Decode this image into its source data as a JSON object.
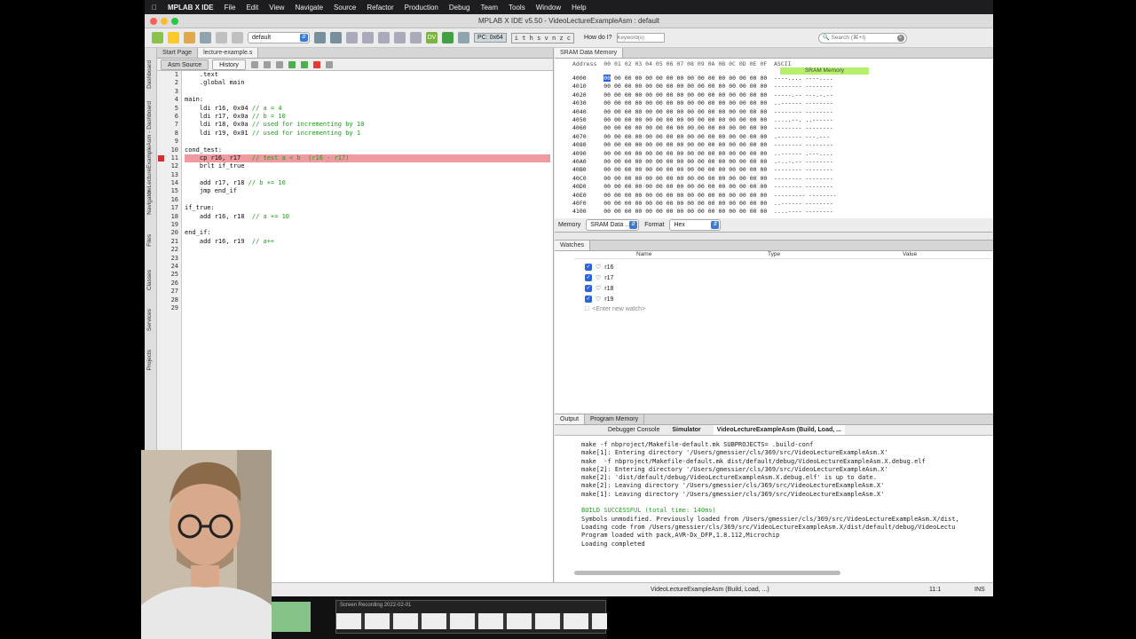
{
  "mac_menu": [
    "MPLAB X IDE",
    "File",
    "Edit",
    "View",
    "Navigate",
    "Source",
    "Refactor",
    "Production",
    "Debug",
    "Team",
    "Tools",
    "Window",
    "Help"
  ],
  "window_title": "MPLAB X IDE v5.50 - VideoLectureExampleAsm : default",
  "toolbar": {
    "config": "default",
    "pc": "PC: 0x64",
    "status_flags": "i t h s v n z c",
    "howdoi": "How do I?",
    "howdoi_placeholder": "Keyword(s)",
    "search_placeholder": "Search (⌘+I)"
  },
  "sidebar_tabs": [
    "Dashboard",
    "dwLectureExampleAsm - Dashboard",
    "Navigator",
    "Files",
    "Classes",
    "Services",
    "Projects"
  ],
  "editor": {
    "tabs": [
      "Start Page",
      "lecture-example.s"
    ],
    "subtabs": [
      "Asm Source",
      "History"
    ],
    "lines": [
      "    .text",
      "    .global main",
      "",
      "main:",
      "    ldi r16, 0x04 // a = 4",
      "    ldi r17, 0x0a // b = 10",
      "    ldi r18, 0x0a // used for incrementing by 10",
      "    ldi r19, 0x01 // used for incrementing by 1",
      "",
      "cond_test:",
      "    cp r16, r17   // test a < b  (r16 - r17)",
      "    brlt if_true",
      "",
      "    add r17, r18 // b += 10",
      "    jmp end_if",
      "",
      "if_true:",
      "    add r16, r18  // a += 10",
      "",
      "end_if:",
      "    add r16, r19  // a++",
      "",
      "",
      "",
      "",
      "",
      "",
      "",
      ""
    ],
    "breakpoint_line": 11
  },
  "sram": {
    "tab": "SRAM Data Memory",
    "header": "Address  00 01 02 03 04 05 06 07 08 09 0A 0B 0C 0D 0E 0F  ASCII",
    "overlay_label": "SRAM Memory",
    "rows": [
      {
        "addr": "4000",
        "bytes": "00 00 00 00 00 00 00 00 00 00 00 00 00 00 00 00",
        "ascii": "----.... ----...."
      },
      {
        "addr": "4010",
        "bytes": "00 00 00 00 00 00 00 00 00 00 00 00 00 00 00 00",
        "ascii": "-------- --------"
      },
      {
        "addr": "4020",
        "bytes": "00 00 00 00 00 00 00 00 00 00 00 00 00 00 00 00",
        "ascii": "-----.-- ---.-.--"
      },
      {
        "addr": "4030",
        "bytes": "00 00 00 00 00 00 00 00 00 00 00 00 00 00 00 00",
        "ascii": "..------ --------"
      },
      {
        "addr": "4040",
        "bytes": "00 00 00 00 00 00 00 00 00 00 00 00 00 00 00 00",
        "ascii": "-------- --------"
      },
      {
        "addr": "4050",
        "bytes": "00 00 00 00 00 00 00 00 00 00 00 00 00 00 00 00",
        "ascii": ".....--. ..------"
      },
      {
        "addr": "4060",
        "bytes": "00 00 00 00 00 00 00 00 00 00 00 00 00 00 00 00",
        "ascii": "-------- --------"
      },
      {
        "addr": "4070",
        "bytes": "00 00 00 00 00 00 00 00 00 00 00 00 00 00 00 00",
        "ascii": ".------- ---.---"
      },
      {
        "addr": "4080",
        "bytes": "00 00 00 00 00 00 00 00 00 00 00 00 00 00 00 00",
        "ascii": "-------- --------"
      },
      {
        "addr": "4090",
        "bytes": "00 00 00 00 00 00 00 00 00 00 00 00 00 00 00 00",
        "ascii": "..------ .---...."
      },
      {
        "addr": "40A0",
        "bytes": "00 00 00 00 00 00 00 00 00 00 00 00 00 00 00 00",
        "ascii": ".-..-.-- --------"
      },
      {
        "addr": "40B0",
        "bytes": "00 00 00 00 00 00 00 00 00 00 00 00 00 00 00 00",
        "ascii": "-------- --------"
      },
      {
        "addr": "40C0",
        "bytes": "00 00 00 00 00 00 00 00 00 00 00 00 00 00 00 00",
        "ascii": "-------- --------"
      },
      {
        "addr": "40D0",
        "bytes": "00 00 00 00 00 00 00 00 00 00 00 00 00 00 00 00",
        "ascii": "-------- --------"
      },
      {
        "addr": "40E0",
        "bytes": "00 00 00 00 00 00 00 00 00 00 00 00 00 00 00 00",
        "ascii": "--------- --------"
      },
      {
        "addr": "40F0",
        "bytes": "00 00 00 00 00 00 00 00 00 00 00 00 00 00 00 00",
        "ascii": "..------ --------"
      },
      {
        "addr": "4100",
        "bytes": "00 00 00 00 00 00 00 00 00 00 00 00 00 00 00 00",
        "ascii": "....---- --------"
      }
    ],
    "memory_label": "Memory",
    "memory_value": "SRAM Data ...",
    "format_label": "Format",
    "format_value": "Hex"
  },
  "watches": {
    "tab": "Watches",
    "cols": [
      "Name",
      "Type",
      "Value"
    ],
    "items": [
      "r16",
      "r17",
      "r18",
      "r19"
    ],
    "new_placeholder": "<Enter new watch>"
  },
  "output": {
    "tabs": [
      "Output",
      "Program Memory"
    ],
    "subtabs": [
      "Debugger Console",
      "Simulator",
      "VideoLectureExampleAsm (Build, Load, ..."
    ],
    "lines": [
      {
        "t": "make -f nbproject/Makefile-default.mk SUBPROJECTS= .build-conf",
        "g": false
      },
      {
        "t": "make[1]: Entering directory '/Users/gmessier/cls/369/src/VideoLectureExampleAsm.X'",
        "g": false
      },
      {
        "t": "make  -f nbproject/Makefile-default.mk dist/default/debug/VideoLectureExampleAsm.X.debug.elf",
        "g": false
      },
      {
        "t": "make[2]: Entering directory '/Users/gmessier/cls/369/src/VideoLectureExampleAsm.X'",
        "g": false
      },
      {
        "t": "make[2]: 'dist/default/debug/VideoLectureExampleAsm.X.debug.elf' is up to date.",
        "g": false
      },
      {
        "t": "make[2]: Leaving directory '/Users/gmessier/cls/369/src/VideoLectureExampleAsm.X'",
        "g": false
      },
      {
        "t": "make[1]: Leaving directory '/Users/gmessier/cls/369/src/VideoLectureExampleAsm.X'",
        "g": false
      },
      {
        "t": "",
        "g": false
      },
      {
        "t": "BUILD SUCCESSFUL (total time: 140ms)",
        "g": true
      },
      {
        "t": "Symbols unmodified. Previously loaded from /Users/gmessier/cls/369/src/VideoLectureExampleAsm.X/dist,",
        "g": false
      },
      {
        "t": "Loading code from /Users/gmessier/cls/369/src/VideoLectureExampleAsm.X/dist/default/debug/VideoLectu",
        "g": false
      },
      {
        "t": "Program loaded with pack,AVR-Dx_DFP,1.8.112,Microchip",
        "g": false
      },
      {
        "t": "Loading completed",
        "g": false
      }
    ]
  },
  "status": {
    "task": "VideoLectureExampleAsm (Build, Load, ...)",
    "pos": "11:1",
    "mode": "INS"
  },
  "dock": {
    "recording_label": "Screen Recording 2022-02-01"
  }
}
